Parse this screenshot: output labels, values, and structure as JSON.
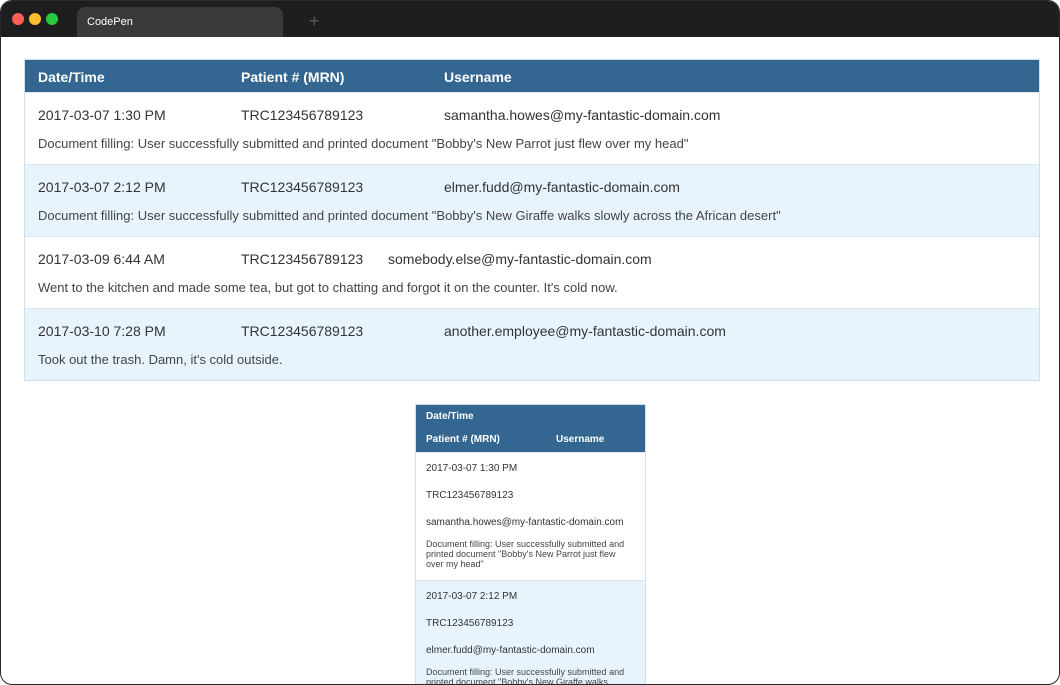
{
  "window": {
    "tab_title": "CodePen",
    "new_tab_symbol": "+"
  },
  "table": {
    "headers": {
      "datetime": "Date/Time",
      "patient": "Patient # (MRN)",
      "username": "Username"
    },
    "rows": [
      {
        "datetime": "2017-03-07 1:30 PM",
        "patient": "TRC123456789123",
        "username": "samantha.howes@my-fantastic-domain.com",
        "note": "Document filling: User successfully submitted and printed document \"Bobby's New Parrot just flew over my head\""
      },
      {
        "datetime": "2017-03-07 2:12 PM",
        "patient": "TRC123456789123",
        "username": "elmer.fudd@my-fantastic-domain.com",
        "note": "Document filling: User successfully submitted and printed document \"Bobby's New Giraffe walks slowly across the African desert\""
      },
      {
        "datetime": "2017-03-09 6:44 AM",
        "patient": "TRC123456789123",
        "username": "somebody.else@my-fantastic-domain.com",
        "note": "Went to the kitchen and made some tea, but got to chatting and forgot it on the counter. It's cold now."
      },
      {
        "datetime": "2017-03-10 7:28 PM",
        "patient": "TRC123456789123",
        "username": "another.employee@my-fantastic-domain.com",
        "note": "Took out the trash. Damn, it's cold outside."
      }
    ]
  },
  "narrow_table": {
    "row1_note_lines": [
      "Document filling: User successfully submitted and",
      "printed document \"Bobby's New Parrot just flew",
      "over my head\""
    ],
    "row2_note_lines": [
      "Document filling: User successfully submitted and",
      "printed document \"Bobby's New Giraffe walks"
    ]
  }
}
